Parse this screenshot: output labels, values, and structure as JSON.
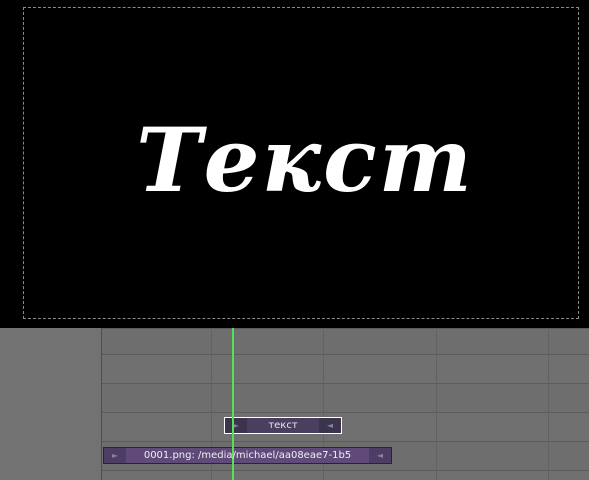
{
  "preview": {
    "text": "Текст"
  },
  "sequencer": {
    "strips": [
      {
        "label": "текст",
        "type": "text"
      },
      {
        "label": "0001.png: /media/michael/aa08eae7-1b5",
        "type": "image"
      }
    ],
    "handle_glyphs": {
      "left": "►",
      "right": "◄"
    },
    "colors": {
      "text_strip": "#4a3f5e",
      "image_strip": "#5f4a7a",
      "playhead": "#56e056",
      "selected_outline": "#ffffff"
    }
  }
}
